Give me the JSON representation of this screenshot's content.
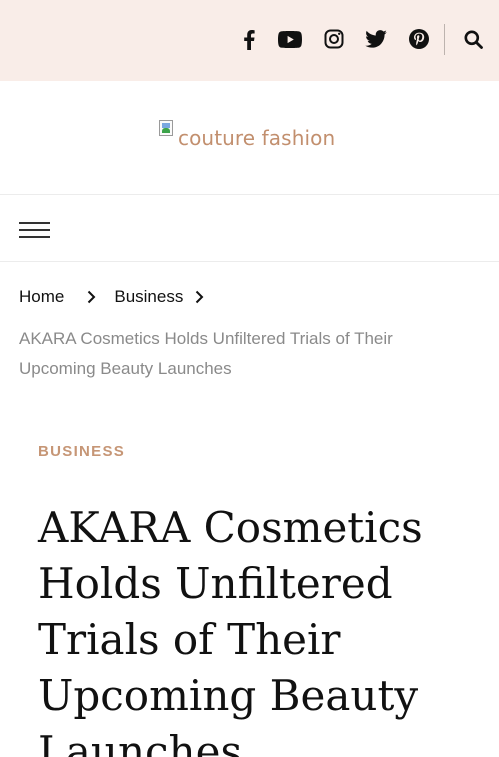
{
  "topbar": {
    "social_icons": [
      "facebook-icon",
      "youtube-icon",
      "instagram-icon",
      "twitter-icon",
      "pinterest-icon"
    ],
    "search_icon": "search-icon"
  },
  "header": {
    "logo_alt": "couture fashion"
  },
  "breadcrumb": {
    "items": [
      "Home",
      "Business"
    ],
    "current": "AKARA Cosmetics Holds Unfiltered Trials of Their Upcoming Beauty Launches"
  },
  "article": {
    "category": "BUSINESS",
    "title": "AKARA Cosmetics Holds Unfiltered Trials of Their Upcoming Beauty Launches"
  },
  "colors": {
    "topbar_bg": "#f9ede8",
    "accent": "#c69676",
    "logo_text": "#c28f6e"
  }
}
